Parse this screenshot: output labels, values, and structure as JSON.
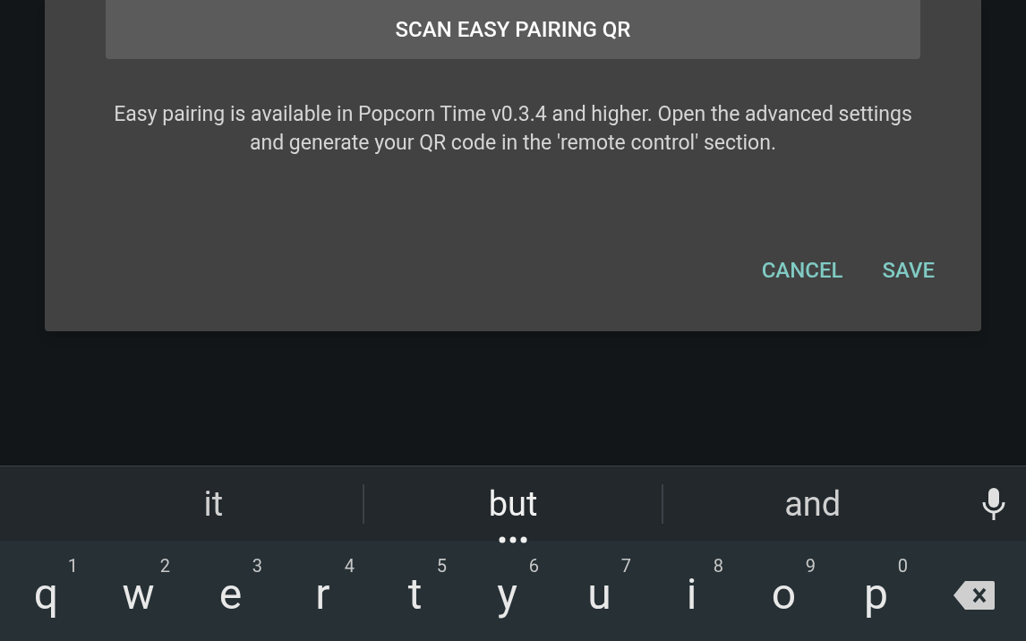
{
  "dialog": {
    "scan_button": "SCAN EASY PAIRING QR",
    "message": "Easy pairing is available in Popcorn Time v0.3.4 and higher. Open the advanced settings and generate your QR code in the 'remote control' section.",
    "actions": [
      "CANCEL",
      "SAVE"
    ]
  },
  "keyboard": {
    "suggestions": [
      {
        "text": "it",
        "selected": false
      },
      {
        "text": "but",
        "selected": true
      },
      {
        "text": "and",
        "selected": false
      }
    ],
    "keys": [
      {
        "letter": "q",
        "hint": "1"
      },
      {
        "letter": "w",
        "hint": "2"
      },
      {
        "letter": "e",
        "hint": "3"
      },
      {
        "letter": "r",
        "hint": "4"
      },
      {
        "letter": "t",
        "hint": "5"
      },
      {
        "letter": "y",
        "hint": "6"
      },
      {
        "letter": "u",
        "hint": "7"
      },
      {
        "letter": "i",
        "hint": "8"
      },
      {
        "letter": "o",
        "hint": "9"
      },
      {
        "letter": "p",
        "hint": "0"
      }
    ]
  }
}
